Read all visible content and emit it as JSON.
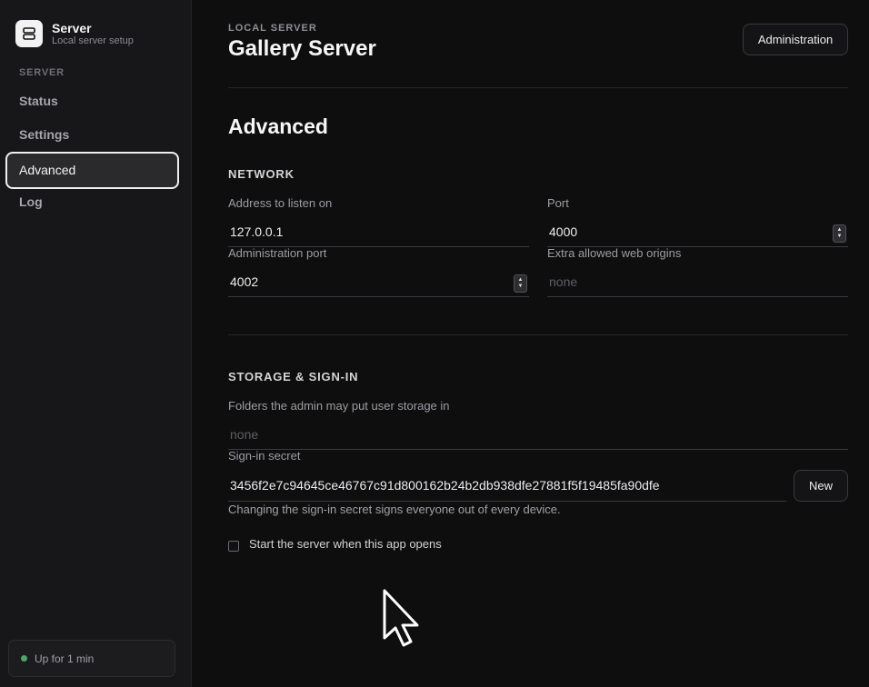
{
  "sidebar": {
    "brand_title": "Server",
    "brand_subtitle": "Local server setup",
    "section": "SERVER",
    "items": [
      {
        "label": "Status"
      },
      {
        "label": "Settings"
      },
      {
        "label": "Advanced",
        "active": true
      },
      {
        "label": "Log"
      }
    ],
    "status": "Up for 1 min",
    "status_color": "#4fa66a"
  },
  "header": {
    "eyebrow": "LOCAL SERVER",
    "title": "Gallery Server",
    "admin_button": "Administration"
  },
  "main": {
    "title": "Advanced",
    "network": {
      "title": "NETWORK",
      "address_label": "Address to listen on",
      "address_value": "127.0.0.1",
      "port_label": "Port",
      "port_value": "4000",
      "admin_port_label": "Administration port",
      "admin_port_value": "4002",
      "origins_label": "Extra allowed web origins",
      "origins_placeholder": "none"
    },
    "storage": {
      "title": "STORAGE & SIGN-IN",
      "folders_label": "Folders the admin may put user storage in",
      "folders_placeholder": "none",
      "secret_label": "Sign-in secret",
      "secret_value": "3456f2e7c94645ce46767c91d800162b24b2db938dfe27881f5f19485fa90dfe",
      "new_button": "New",
      "hint": "Changing the sign-in secret signs everyone out of every device.",
      "autostart_label": "Start the server when this app opens",
      "autostart_checked": false
    }
  }
}
